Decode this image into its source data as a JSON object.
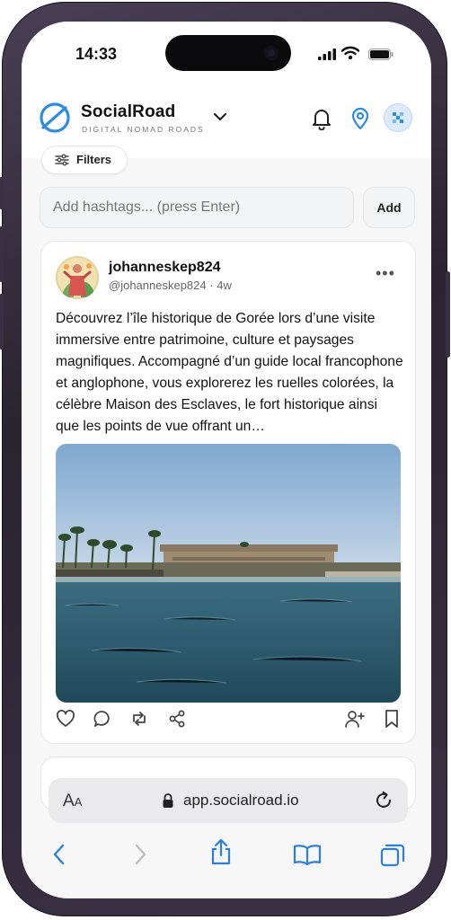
{
  "status_bar": {
    "time": "14:33"
  },
  "header": {
    "brand": "SocialRoad",
    "tagline": "DIGITAL NOMAD ROADS"
  },
  "filters": {
    "label": "Filters"
  },
  "hashtags": {
    "placeholder": "Add hashtags... (press Enter)",
    "add_label": "Add"
  },
  "post": {
    "username": "johanneskep824",
    "handle": "@johanneskep824",
    "separator": "·",
    "age": "4w",
    "text": "Découvrez l’île historique de Gorée lors d’une visite immersive entre patrimoine, culture et paysages magnifiques. Accompagné d’un guide local francophone et anglophone, vous explorerez les ruelles colorées, la célèbre Maison des Esclaves, le fort historique ainsi que les points de vue offrant un…",
    "more_label": "•••"
  },
  "browser": {
    "text_size_large": "A",
    "text_size_small": "A",
    "url": "app.socialroad.io"
  },
  "colors": {
    "accent": "#2b8de3",
    "card_border": "#e8e8ea",
    "background": "#f7f7f8"
  }
}
